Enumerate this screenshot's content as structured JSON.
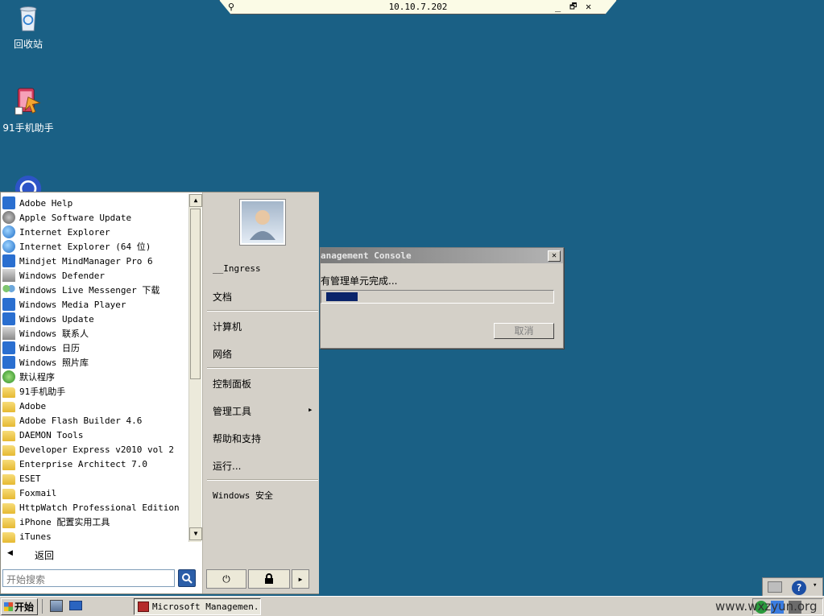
{
  "desktop": {
    "icons": [
      {
        "label": "回收站",
        "icon": "recycle-bin-icon"
      },
      {
        "label": "91手机助手",
        "icon": "phone-assistant-icon"
      },
      {
        "label": "",
        "icon": "browser-icon"
      }
    ]
  },
  "remote_bar": {
    "title": "10.10.7.202",
    "pin": "⚲",
    "minimize": "_",
    "restore": "🗗",
    "close": "✕"
  },
  "start_menu": {
    "programs": [
      {
        "label": "Adobe Help",
        "icon": "info-icon"
      },
      {
        "label": "Apple Software Update",
        "icon": "apple-update-icon"
      },
      {
        "label": "Internet Explorer",
        "icon": "ie-icon"
      },
      {
        "label": "Internet Explorer (64 位)",
        "icon": "ie-icon"
      },
      {
        "label": "Mindjet MindManager Pro 6",
        "icon": "mindmap-icon"
      },
      {
        "label": "Windows Defender",
        "icon": "defender-icon"
      },
      {
        "label": "Windows Live Messenger 下载",
        "icon": "messenger-icon"
      },
      {
        "label": "Windows Media Player",
        "icon": "media-player-icon"
      },
      {
        "label": "Windows Update",
        "icon": "windows-update-icon"
      },
      {
        "label": "Windows 联系人",
        "icon": "contacts-icon"
      },
      {
        "label": "Windows 日历",
        "icon": "calendar-icon"
      },
      {
        "label": "Windows 照片库",
        "icon": "photo-gallery-icon"
      },
      {
        "label": "默认程序",
        "icon": "default-programs-icon"
      },
      {
        "label": "91手机助手",
        "icon": "folder-icon"
      },
      {
        "label": "Adobe",
        "icon": "folder-icon"
      },
      {
        "label": "Adobe Flash Builder 4.6",
        "icon": "folder-icon"
      },
      {
        "label": "DAEMON Tools",
        "icon": "folder-icon"
      },
      {
        "label": "Developer Express v2010 vol 2",
        "icon": "folder-icon"
      },
      {
        "label": "Enterprise Architect 7.0",
        "icon": "folder-icon"
      },
      {
        "label": "ESET",
        "icon": "folder-icon"
      },
      {
        "label": "Foxmail",
        "icon": "folder-icon"
      },
      {
        "label": "HttpWatch Professional Edition",
        "icon": "folder-icon"
      },
      {
        "label": "iPhone 配置实用工具",
        "icon": "folder-icon"
      },
      {
        "label": "iTunes",
        "icon": "folder-icon"
      }
    ],
    "back_label": "返回",
    "back_arrow": "◀",
    "search_placeholder": "开始搜索",
    "search_icon": "🔍",
    "scroll_up": "▲",
    "scroll_down": "▼",
    "right": {
      "user": "__Ingress",
      "documents": "文档",
      "computer": "计算机",
      "network": "网络",
      "control_panel": "控制面板",
      "admin_tools": "管理工具",
      "admin_arrow": "▸",
      "help": "帮助和支持",
      "run": "运行...",
      "security": "Windows 安全"
    },
    "power_glyph": "⏻",
    "lock_glyph": "🔒",
    "more_glyph": "▸"
  },
  "dialog": {
    "title": "anagement Console",
    "message": "有管理单元完成...",
    "progress": 0.14,
    "cancel_label": "取消",
    "close_glyph": "✕"
  },
  "taskbar": {
    "start_label": "开始",
    "task_label": "Microsoft Managemen..."
  },
  "watermark": "www.wxzyun.org",
  "colors": {
    "desktop": "#1a6085",
    "progress_fill": "#0a246a"
  }
}
